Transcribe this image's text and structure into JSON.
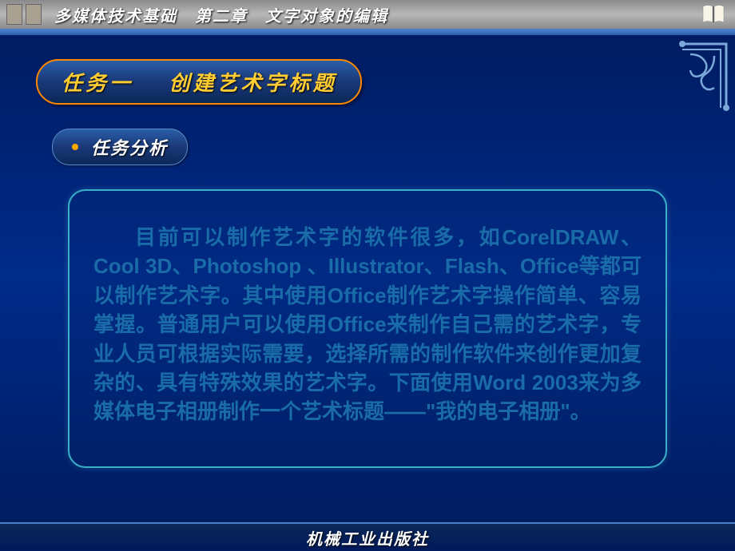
{
  "header": {
    "title": "多媒体技术基础　第二章　文字对象的编辑"
  },
  "task": {
    "part1": "任务一",
    "part2": "创建艺术字标题"
  },
  "subtask": {
    "label": "任务分析"
  },
  "body": {
    "text": "目前可以制作艺术字的软件很多，如CorelDRAW、Cool 3D、Photoshop 、Illustrator、Flash、Office等都可以制作艺术字。其中使用Office制作艺术字操作简单、容易掌握。普通用户可以使用Office来制作自己需的艺术字，专业人员可根据实际需要，选择所需的制作软件来创作更加复杂的、具有特殊效果的艺术字。下面使用Word 2003来为多媒体电子相册制作一个艺术标题——\"我的电子相册\"。"
  },
  "footer": {
    "publisher": "机械工业出版社"
  }
}
